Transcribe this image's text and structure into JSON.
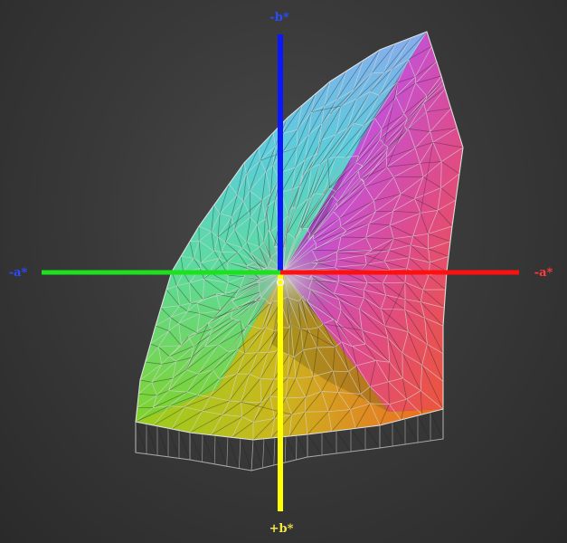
{
  "axis_labels": {
    "minus_b": "-b*",
    "plus_b": "+b*",
    "minus_a": "-a*",
    "plus_a": "-a*"
  },
  "colors": {
    "minus_b_axis": "#0b17ff",
    "plus_b_axis": "#ffff00",
    "minus_a_axis": "#1ee11e",
    "plus_a_axis": "#ff1010",
    "minus_b_label": "#2b4bff",
    "plus_b_label": "#f5e64a",
    "minus_a_label": "#2b4bff",
    "plus_a_label": "#ff3b3b",
    "wireframe": "#d8d8d8",
    "background": "#3a3a3a"
  }
}
